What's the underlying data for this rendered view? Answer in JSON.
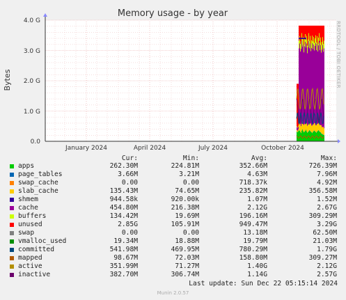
{
  "chart_data": {
    "type": "area",
    "title": "Memory usage - by year",
    "ylabel": "Bytes",
    "side_label": "RRDTOOL / TOBI OETIKER",
    "y_ticks": [
      "0.0",
      "1.0 G",
      "2.0 G",
      "3.0 G",
      "4.0 G"
    ],
    "ylim": [
      0,
      4.0
    ],
    "x_ticks": [
      "January 2024",
      "April 2024",
      "July 2024",
      "October 2024"
    ],
    "grid": true,
    "columns": [
      "Cur:",
      "Min:",
      "Avg:",
      "Max:"
    ],
    "series": [
      {
        "name": "apps",
        "color": "#00cc00",
        "cur": "262.30M",
        "min": "224.81M",
        "avg": "352.66M",
        "max": "726.39M"
      },
      {
        "name": "page_tables",
        "color": "#0066b3",
        "cur": "3.66M",
        "min": "3.21M",
        "avg": "4.63M",
        "max": "7.96M"
      },
      {
        "name": "swap_cache",
        "color": "#ff8000",
        "cur": "0.00",
        "min": "0.00",
        "avg": "718.37k",
        "max": "4.92M"
      },
      {
        "name": "slab_cache",
        "color": "#ffcc00",
        "cur": "135.43M",
        "min": "74.65M",
        "avg": "235.82M",
        "max": "356.58M"
      },
      {
        "name": "shmem",
        "color": "#330099",
        "cur": "944.58k",
        "min": "920.00k",
        "avg": "1.07M",
        "max": "1.52M"
      },
      {
        "name": "cache",
        "color": "#990099",
        "cur": "454.80M",
        "min": "216.38M",
        "avg": "2.12G",
        "max": "2.67G"
      },
      {
        "name": "buffers",
        "color": "#ccff00",
        "cur": "134.42M",
        "min": "19.69M",
        "avg": "196.16M",
        "max": "309.29M"
      },
      {
        "name": "unused",
        "color": "#ff0000",
        "cur": "2.85G",
        "min": "105.91M",
        "avg": "949.47M",
        "max": "3.29G"
      },
      {
        "name": "swap",
        "color": "#808080",
        "cur": "0.00",
        "min": "0.00",
        "avg": "13.18M",
        "max": "62.50M"
      },
      {
        "name": "vmalloc_used",
        "color": "#008f00",
        "cur": "19.34M",
        "min": "18.88M",
        "avg": "19.79M",
        "max": "21.03M"
      },
      {
        "name": "committed",
        "color": "#00487d",
        "cur": "541.98M",
        "min": "469.95M",
        "avg": "780.29M",
        "max": "1.79G"
      },
      {
        "name": "mapped",
        "color": "#b35a00",
        "cur": "98.67M",
        "min": "72.03M",
        "avg": "158.80M",
        "max": "309.27M"
      },
      {
        "name": "active",
        "color": "#b38f00",
        "cur": "351.99M",
        "min": "71.27M",
        "avg": "1.40G",
        "max": "2.12G"
      },
      {
        "name": "inactive",
        "color": "#6b006b",
        "cur": "382.70M",
        "min": "306.74M",
        "avg": "1.14G",
        "max": "2.57G"
      }
    ]
  },
  "footer": {
    "last_update": "Last update: Sun Dec 22 05:15:14 2024",
    "munin": "Munin 2.0.57"
  }
}
